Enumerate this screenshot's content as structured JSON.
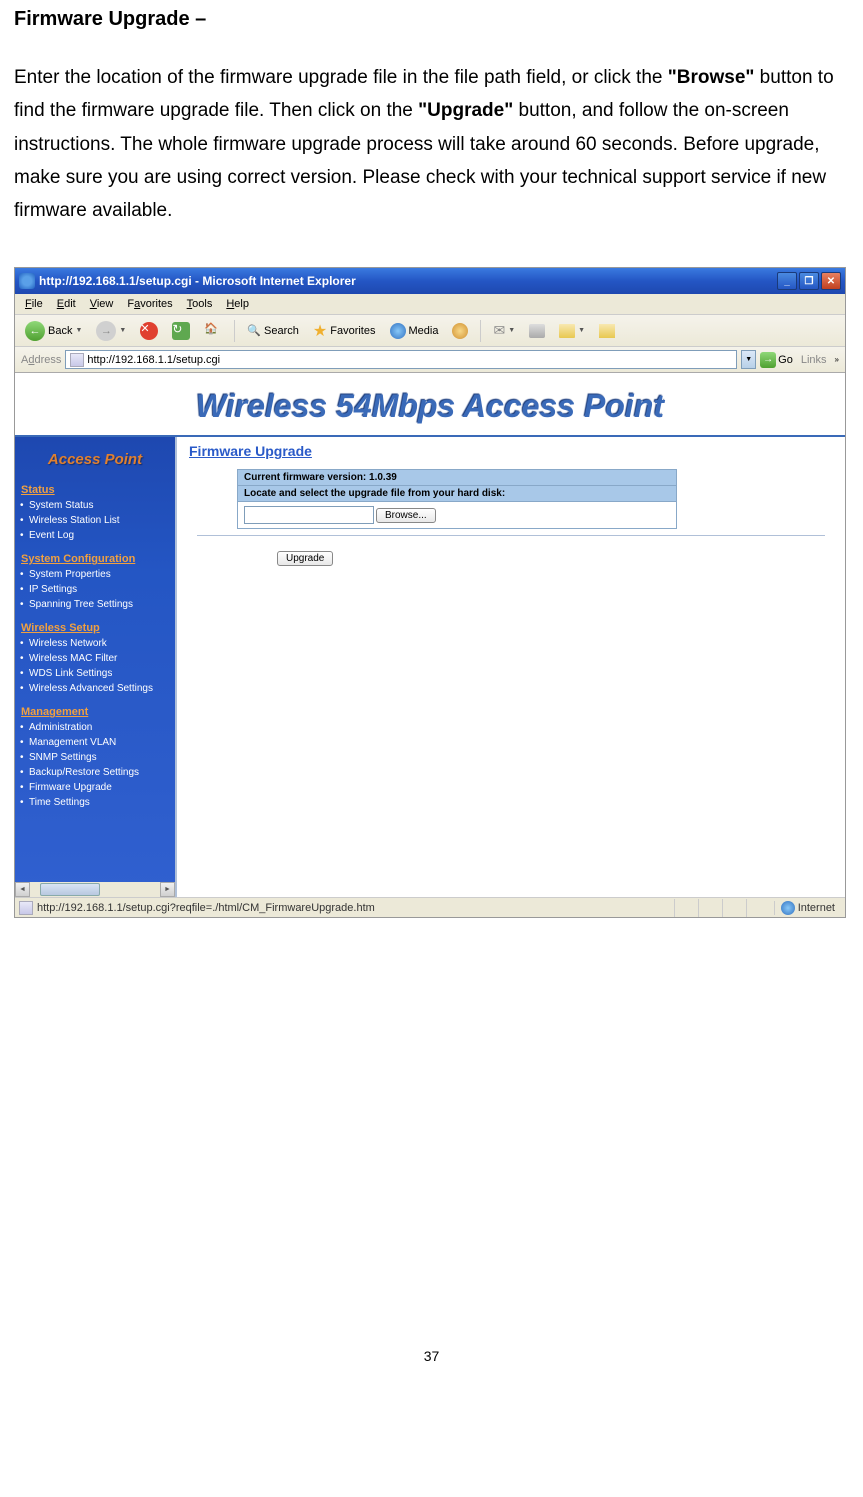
{
  "doc": {
    "title": "Firmware Upgrade –",
    "body_p1": "Enter the location of the firmware upgrade file in the file path field, or click the ",
    "body_browse": "\"Browse\"",
    "body_p2": " button to find the firmware upgrade file.    Then click on the ",
    "body_upgrade": "\"Upgrade\"",
    "body_p3": " button, and follow the on-screen instructions. The whole firmware upgrade process will take around 60 seconds. Before upgrade, make sure you are using correct version. Please check with your technical support service if new firmware available.",
    "page_number": "37"
  },
  "browser": {
    "title": "http://192.168.1.1/setup.cgi - Microsoft Internet Explorer",
    "menu": {
      "file": "File",
      "edit": "Edit",
      "view": "View",
      "favorites": "Favorites",
      "tools": "Tools",
      "help": "Help"
    },
    "toolbar": {
      "back": "Back",
      "search": "Search",
      "favorites": "Favorites",
      "media": "Media"
    },
    "address_label": "Address",
    "address_url": "http://192.168.1.1/setup.cgi",
    "go": "Go",
    "links": "Links",
    "status_url": "http://192.168.1.1/setup.cgi?reqfile=./html/CM_FirmwareUpgrade.htm",
    "status_zone": "Internet"
  },
  "page": {
    "header_title": "Wireless 54Mbps Access Point",
    "sidebar_title": "Access Point",
    "sections": {
      "status": {
        "label": "Status",
        "items": [
          "System Status",
          "Wireless Station List",
          "Event Log"
        ]
      },
      "sysconf": {
        "label": "System Configuration",
        "items": [
          "System Properties",
          "IP Settings",
          "Spanning Tree Settings"
        ]
      },
      "wireless": {
        "label": "Wireless Setup",
        "items": [
          "Wireless Network",
          "Wireless MAC Filter",
          "WDS Link Settings",
          "Wireless Advanced Settings"
        ]
      },
      "mgmt": {
        "label": "Management",
        "items": [
          "Administration",
          "Management VLAN",
          "SNMP Settings",
          "Backup/Restore Settings",
          "Firmware Upgrade",
          "Time Settings"
        ]
      }
    },
    "main": {
      "title": "Firmware Upgrade",
      "version_label": "Current firmware version: 1.0.39",
      "locate_label": "Locate and select the upgrade file from your hard disk:",
      "browse_btn": "Browse...",
      "upgrade_btn": "Upgrade"
    }
  }
}
